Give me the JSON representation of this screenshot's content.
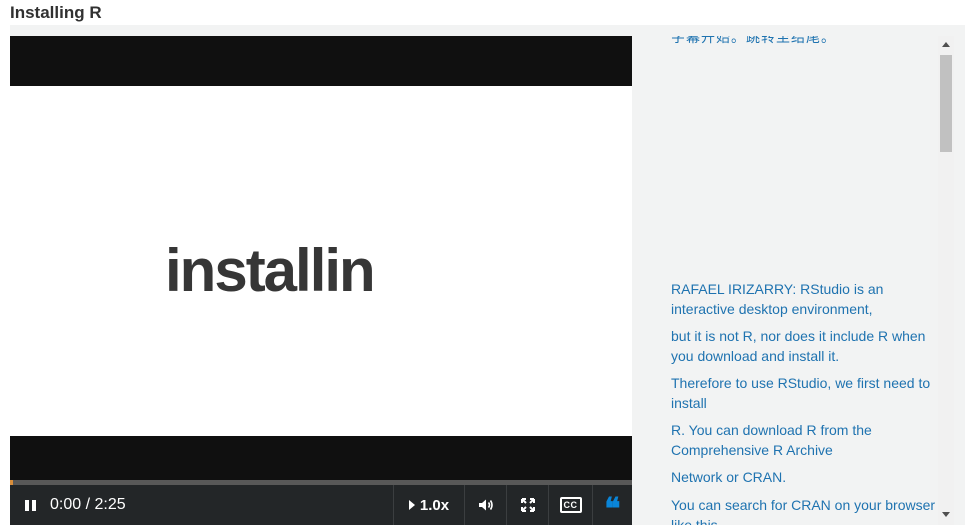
{
  "page": {
    "title": "Installing R"
  },
  "video": {
    "slide_text": "installin",
    "progress_fraction": 0.0,
    "controls": {
      "pause_icon": "pause-icon",
      "time": "0:00 / 2:25",
      "speed_label": "1.0x",
      "volume_icon": "volume-icon",
      "fullscreen_icon": "fullscreen-icon",
      "cc_label": "CC",
      "transcript_icon": "quote-icon",
      "transcript_glyph": "❝"
    }
  },
  "transcript": {
    "lines": [
      "字幕开始。跳转至结尾。",
      "RAFAEL IRIZARRY: RStudio is an interactive desktop environment,",
      "but it is not R, nor does it include R when you download and install it.",
      "Therefore to use RStudio, we first need to install",
      "R. You can download R from the Comprehensive R Archive",
      "Network or CRAN.",
      "You can search for CRAN on your browser like this."
    ]
  },
  "colors": {
    "transcript_text": "#1f73b0",
    "controls_bg": "#232628",
    "accent": "#0a85d8",
    "progress_handle": "#d98e3b"
  }
}
